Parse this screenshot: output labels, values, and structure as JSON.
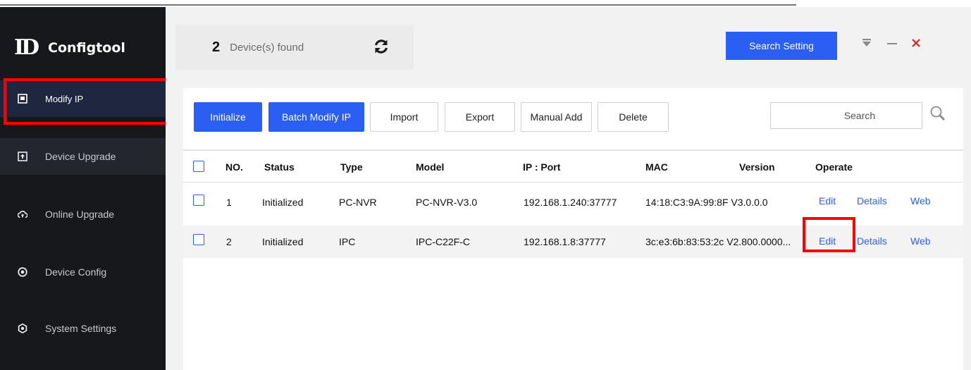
{
  "app": {
    "name": "Configtool",
    "logo_mark": "ID"
  },
  "sidebar": {
    "items": [
      {
        "label": "Modify IP",
        "icon": "ip-icon"
      },
      {
        "label": "Device Upgrade",
        "icon": "upload-icon"
      },
      {
        "label": "Online Upgrade",
        "icon": "cloud-upgrade-icon"
      },
      {
        "label": "Device Config",
        "icon": "config-icon"
      },
      {
        "label": "System Settings",
        "icon": "settings-icon"
      }
    ]
  },
  "header": {
    "device_count": "2",
    "found_label": "Device(s) found",
    "search_setting_label": "Search Setting"
  },
  "toolbar": {
    "initialize": "Initialize",
    "batch_modify": "Batch Modify IP",
    "import": "Import",
    "export": "Export",
    "manual_add": "Manual Add",
    "delete": "Delete",
    "search_placeholder": "Search"
  },
  "table": {
    "headers": [
      "NO.",
      "Status",
      "Type",
      "Model",
      "IP : Port",
      "MAC",
      "Version",
      "Operate"
    ],
    "rows": [
      {
        "no": "1",
        "status": "Initialized",
        "type": "PC-NVR",
        "model": "PC-NVR-V3.0",
        "ip": "192.168.1.240:37777",
        "mac": "14:18:C3:9A:99:8F V3.0.0.0",
        "version": "",
        "edit": "Edit",
        "details": "Details",
        "web": "Web"
      },
      {
        "no": "2",
        "status": "Initialized",
        "type": "IPC",
        "model": "IPC-C22F-C",
        "ip": "192.168.1.8:37777",
        "mac": "3c:e3:6b:83:53:2c  V2.800.0000...",
        "version": "",
        "edit": "Edit",
        "details": "Details",
        "web": "Web"
      }
    ]
  },
  "colors": {
    "accent": "#2b5ff4",
    "sidebar_bg": "#17181c",
    "highlight": "#ff0000",
    "close": "#e0201a"
  }
}
